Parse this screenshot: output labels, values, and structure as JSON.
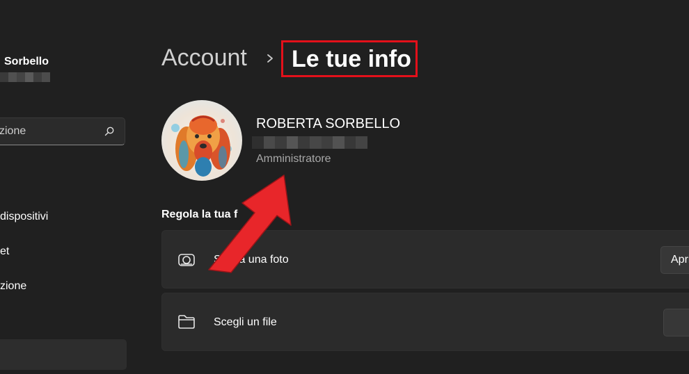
{
  "sidebar": {
    "user_name": "Sorbello",
    "search_text": "zione",
    "nav_items": [
      {
        "label": "dispositivi"
      },
      {
        "label": "et"
      },
      {
        "label": "zione"
      }
    ]
  },
  "header": {
    "breadcrumb_root": "Account",
    "title": "Le tue info"
  },
  "profile": {
    "name": "ROBERTA SORBELLO",
    "role": "Amministratore"
  },
  "section": {
    "title": "Regola la tua f",
    "cards": [
      {
        "label": "Scatta una foto",
        "icon": "camera-icon",
        "button_label": "Apri"
      },
      {
        "label": "Scegli un file",
        "icon": "folder-icon",
        "button_label": ""
      }
    ]
  },
  "colors": {
    "background": "#202020",
    "card": "#2b2b2b",
    "highlight_border": "#e3101a",
    "annotation_arrow": "#e8262a",
    "secondary_text": "#a8a8a8"
  }
}
